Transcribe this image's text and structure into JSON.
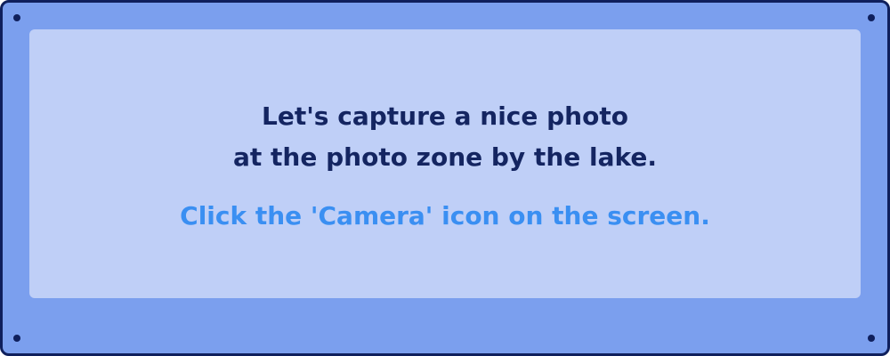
{
  "message": {
    "line1": "Let's capture a nice photo",
    "line2": "at the photo zone by the lake."
  },
  "instruction": "Click the 'Camera' icon on the screen.",
  "colors": {
    "frame": "#7b9fee",
    "border": "#0f1f5c",
    "panel": "#bfcff7",
    "text_dark": "#142561",
    "text_accent": "#3a8ff2"
  }
}
